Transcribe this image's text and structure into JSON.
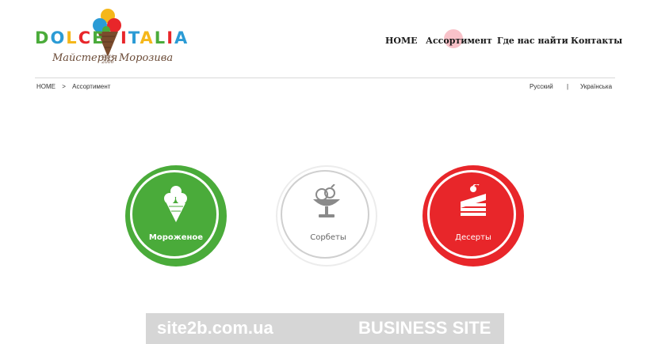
{
  "brand": {
    "name_left": "DOLCE",
    "name_right": "ITALIA",
    "tagline_left": "Майстерня",
    "tagline_right": "Морозива",
    "since_label": "since",
    "since_year": "2006",
    "colors": {
      "green": "#4aab3a",
      "blue": "#2b9bd5",
      "yellow": "#f5b71a",
      "red": "#e8262a",
      "brown": "#6a4a36"
    }
  },
  "nav": {
    "items": [
      {
        "label": "HOME"
      },
      {
        "label": "Ассортимент"
      },
      {
        "label": "Где нас найти"
      },
      {
        "label": "Контакты"
      }
    ]
  },
  "breadcrumb": {
    "home": "HOME",
    "separator": ">",
    "current": "Ассортимент"
  },
  "languages": {
    "ru": "Русский",
    "separator": "|",
    "ua": "Українська"
  },
  "categories": [
    {
      "label": "Мороженое",
      "icon": "ice-cream-cone-icon",
      "color": "#4aab3a"
    },
    {
      "label": "Сорбеты",
      "icon": "sorbet-cup-icon",
      "color": "#ffffff"
    },
    {
      "label": "Десерты",
      "icon": "cake-slice-icon",
      "color": "#e8262a"
    }
  ],
  "watermark": {
    "left": "site2b.com.ua",
    "right": "BUSINESS SITE"
  }
}
